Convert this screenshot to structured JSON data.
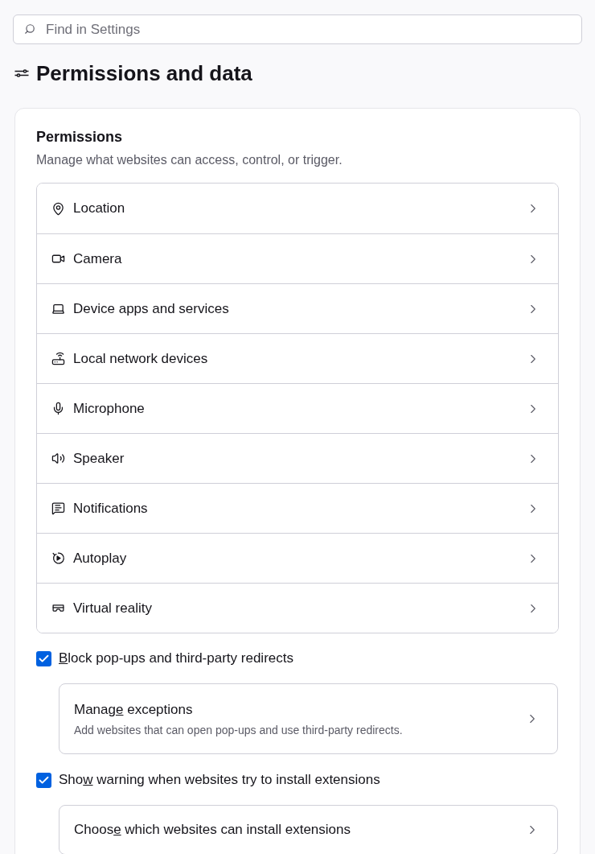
{
  "search": {
    "placeholder": "Find in Settings"
  },
  "page": {
    "title": "Permissions and data"
  },
  "permissions": {
    "title": "Permissions",
    "description": "Manage what websites can access, control, or trigger.",
    "items": [
      "Location",
      "Camera",
      "Device apps and services",
      "Local network devices",
      "Microphone",
      "Speaker",
      "Notifications",
      "Autoplay",
      "Virtual reality"
    ]
  },
  "options": [
    {
      "checked": true,
      "label": {
        "access_key": "B",
        "post": "lock pop-ups and third-party redirects"
      },
      "link": {
        "title": {
          "pre": "Manag",
          "access_key": "e",
          "post": " exceptions"
        },
        "description": "Add websites that can open pop-ups and use third-party redirects."
      }
    },
    {
      "checked": true,
      "label": {
        "pre": "Sho",
        "access_key": "w",
        "post": " warning when websites try to install extensions"
      },
      "link": {
        "title": {
          "pre": "Choos",
          "access_key": "e",
          "post": " which websites can install extensions"
        }
      }
    }
  ]
}
